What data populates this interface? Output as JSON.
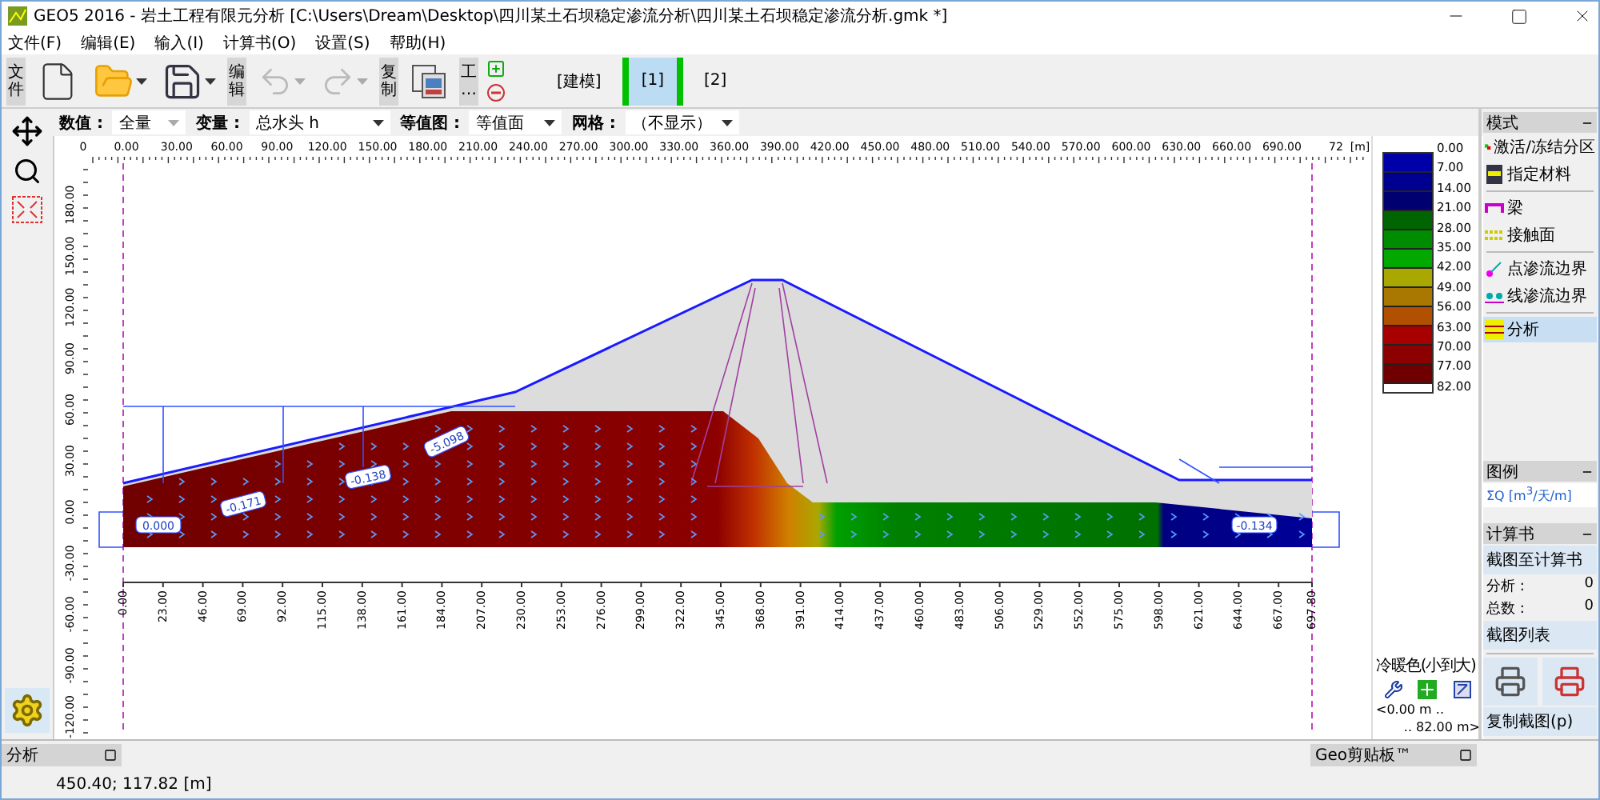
{
  "window": {
    "title": "GEO5 2016 - 岩土工程有限元分析 [C:\\Users\\Dream\\Desktop\\四川某土石坝稳定渗流分析\\四川某土石坝稳定渗流分析.gmk *]"
  },
  "menu": [
    "文件(F)",
    "编辑(E)",
    "输入(I)",
    "计算书(O)",
    "设置(S)",
    "帮助(H)"
  ],
  "toolbar": {
    "file_label": "文件",
    "edit_label": "编辑",
    "undo": {
      "disabled": true
    },
    "redo": {
      "disabled": true
    },
    "copy_label": "复制",
    "tools_label": "工…",
    "stages": [
      {
        "label": "[建模]",
        "selected": false
      },
      {
        "label": "[1]",
        "selected": true
      },
      {
        "label": "[2]",
        "selected": false
      }
    ]
  },
  "options": [
    {
      "label": "数值 :",
      "value": "全量"
    },
    {
      "label": "变量 :",
      "value": "总水头 h"
    },
    {
      "label": "等值图 :",
      "value": "等值面"
    },
    {
      "label": "网格 :",
      "value": "（不显示）"
    }
  ],
  "canvas": {
    "top_ruler": [
      "0",
      "0.00",
      "30.00",
      "60.00",
      "90.00",
      "120.00",
      "150.00",
      "180.00",
      "210.00",
      "240.00",
      "270.00",
      "300.00",
      "330.00",
      "360.00",
      "390.00",
      "420.00",
      "450.00",
      "480.00",
      "510.00",
      "540.00",
      "570.00",
      "600.00",
      "630.00",
      "660.00",
      "690.00",
      "72",
      "[m]"
    ],
    "left_ruler": [
      "180.00",
      "150.00",
      "120.00",
      "90.00",
      "60.00",
      "30.00",
      "0.00",
      "-30.00",
      "-60.00",
      "-90.00",
      "-120.00"
    ],
    "bottom_axis": [
      "0.00",
      "23.00",
      "46.00",
      "69.00",
      "92.00",
      "115.00",
      "138.00",
      "161.00",
      "184.00",
      "207.00",
      "230.00",
      "253.00",
      "276.00",
      "299.00",
      "322.00",
      "345.00",
      "368.00",
      "391.00",
      "414.00",
      "437.00",
      "460.00",
      "483.00",
      "506.00",
      "529.00",
      "552.00",
      "575.00",
      "598.00",
      "621.00",
      "644.00",
      "667.00",
      "697.80"
    ],
    "flow_labels": [
      "0.000",
      "-0.171",
      "-0.138",
      "-5.098",
      "-0.134"
    ]
  },
  "legend": {
    "values": [
      "0.00",
      "7.00",
      "14.00",
      "21.00",
      "28.00",
      "35.00",
      "42.00",
      "49.00",
      "56.00",
      "63.00",
      "70.00",
      "77.00",
      "82.00"
    ],
    "bands": [
      {
        "color": "#0000a8"
      },
      {
        "color": "#000090"
      },
      {
        "color": "#000070"
      },
      {
        "color": "#006400"
      },
      {
        "color": "#008c00"
      },
      {
        "color": "#00a800"
      },
      {
        "color": "#a8a800"
      },
      {
        "color": "#a87800"
      },
      {
        "color": "#b05000"
      },
      {
        "color": "#a80000"
      },
      {
        "color": "#8c0000"
      },
      {
        "color": "#700000"
      }
    ],
    "scheme": "冷暖色(小到大)",
    "min_label": "<0.00 m ..",
    "max_label": ".. 82.00 m>"
  },
  "right_panel": {
    "mode": {
      "title": "模式",
      "groups": [
        [
          {
            "kind": "zones",
            "label": "激活/冻结分区",
            "selected": false
          },
          {
            "kind": "material",
            "label": "指定材料",
            "selected": false
          }
        ],
        [
          {
            "kind": "beam",
            "label": "梁",
            "selected": false
          },
          {
            "kind": "contact",
            "label": "接触面",
            "selected": false
          }
        ],
        [
          {
            "kind": "point",
            "label": "点渗流边界",
            "selected": false
          },
          {
            "kind": "line",
            "label": "线渗流边界",
            "selected": false
          }
        ],
        [
          {
            "kind": "analysis",
            "label": "分析",
            "selected": true
          }
        ]
      ]
    },
    "legend": {
      "title": "图例",
      "unit": "ΣQ [m$^{3}$/天/m]"
    },
    "report": {
      "title": "计算书",
      "add_button": "截图至计算书",
      "counts": [
        {
          "label": "分析 :",
          "value": "0"
        },
        {
          "label": "总数 :",
          "value": "0"
        }
      ],
      "list_button": "截图列表",
      "copy_button": "复制截图(p)"
    }
  },
  "bottom_tabs": [
    "分析",
    "Geo剪贴板™"
  ],
  "status": "450.40; 117.82 [m]"
}
